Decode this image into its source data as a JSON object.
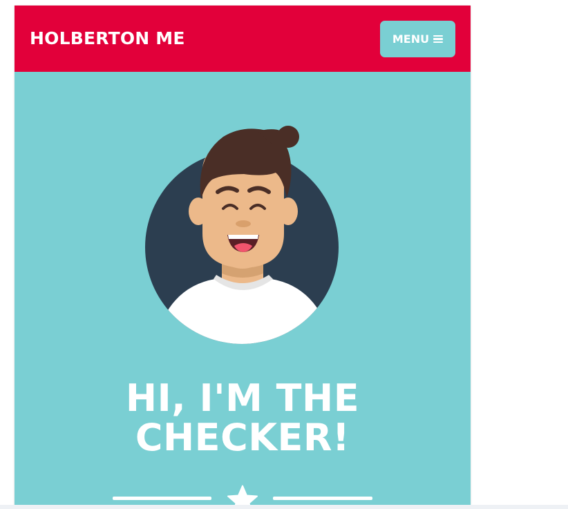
{
  "header": {
    "brand": "HOLBERTON ME",
    "menu_label": "MENU",
    "menu_icon": "hamburger-icon"
  },
  "hero": {
    "avatar_icon": "smiling-person-avatar",
    "title_line1": "HI, I'M THE",
    "title_line2": "CHECKER!",
    "divider_icon": "star-icon"
  },
  "colors": {
    "header_bg": "#e2003a",
    "accent": "#7acfd3",
    "avatar_circle": "#2c3e50",
    "text": "#ffffff"
  }
}
